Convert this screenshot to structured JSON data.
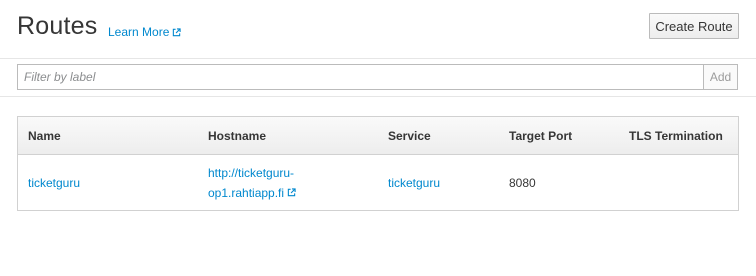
{
  "header": {
    "title": "Routes",
    "learn_more": "Learn More",
    "create_button": "Create Route"
  },
  "filter": {
    "placeholder": "Filter by label",
    "add_button": "Add"
  },
  "table": {
    "columns": [
      "Name",
      "Hostname",
      "Service",
      "Target Port",
      "TLS Termination"
    ],
    "rows": [
      {
        "name": "ticketguru",
        "hostname_line1": "http://ticketguru-",
        "hostname_line2": "op1.rahtiapp.fi",
        "service": "ticketguru",
        "target_port": "8080",
        "tls_termination": ""
      }
    ]
  },
  "colors": {
    "link": "#0088ce",
    "text": "#363636",
    "border": "#d1d1d1"
  },
  "icons": {
    "external_link": "external-link-icon"
  }
}
